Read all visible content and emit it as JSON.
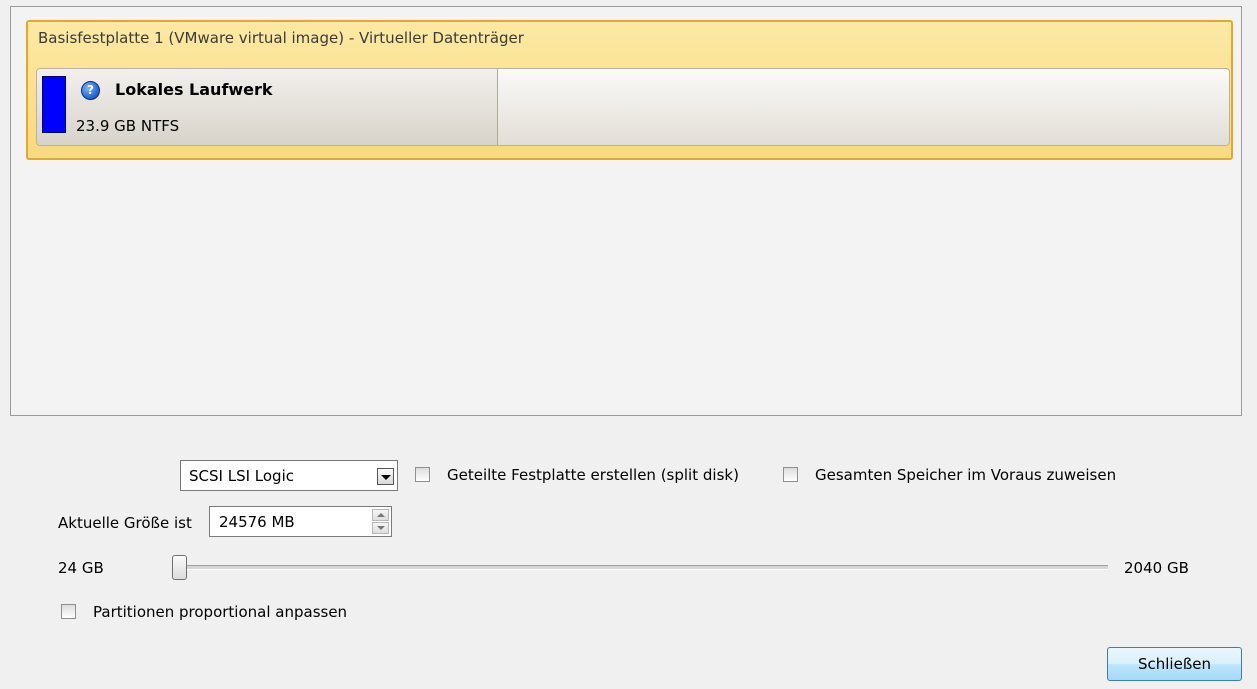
{
  "disk": {
    "title": "Basisfestplatte 1 (VMware virtual image) - Virtueller Datenträger",
    "partition": {
      "name": "Lokales Laufwerk",
      "size": "23.9 GB NTFS",
      "color": "#0000ff",
      "icon": "question-icon"
    }
  },
  "controller": {
    "selected": "SCSI LSI Logic"
  },
  "options": {
    "split_disk_label": "Geteilte Festplatte erstellen (split disk)",
    "split_disk_checked": false,
    "preallocate_label": "Gesamten Speicher im Voraus zuweisen",
    "preallocate_checked": false,
    "proportional_label": "Partitionen proportional anpassen",
    "proportional_checked": false
  },
  "size": {
    "label": "Aktuelle Größe ist",
    "value": "24576 MB"
  },
  "slider": {
    "min_label": "24 GB",
    "max_label": "2040 GB",
    "value_gb": 24
  },
  "buttons": {
    "close_label": "Schließen"
  },
  "colors": {
    "disk_highlight": "#f9d97d",
    "disk_border": "#e3a92a"
  }
}
